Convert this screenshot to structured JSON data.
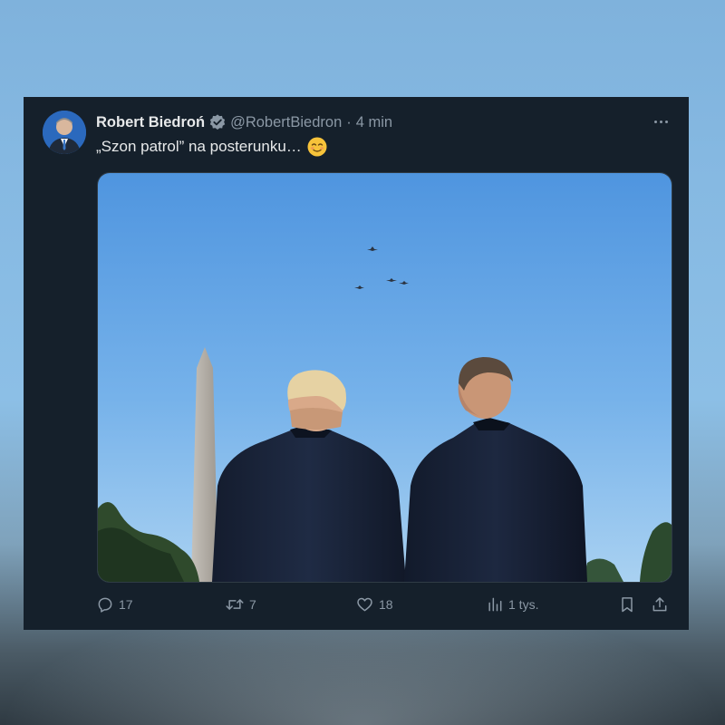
{
  "tweet": {
    "author_name": "Robert Biedroń",
    "handle": "@RobertBiedron",
    "separator": "·",
    "time": "4 min",
    "text": "„Szon patrol” na posterunku…",
    "verified": true
  },
  "icons": {
    "verified": "verified-badge-icon",
    "more": "more-icon",
    "emoji": "smiling-face-emoji"
  },
  "actions": {
    "replies": "17",
    "reposts": "7",
    "likes": "18",
    "views": "1 tys."
  },
  "colors": {
    "card_bg": "#15202b",
    "primary_text": "#e7e9ea",
    "secondary_text": "#8b98a5",
    "verified": "#8b98a5"
  }
}
